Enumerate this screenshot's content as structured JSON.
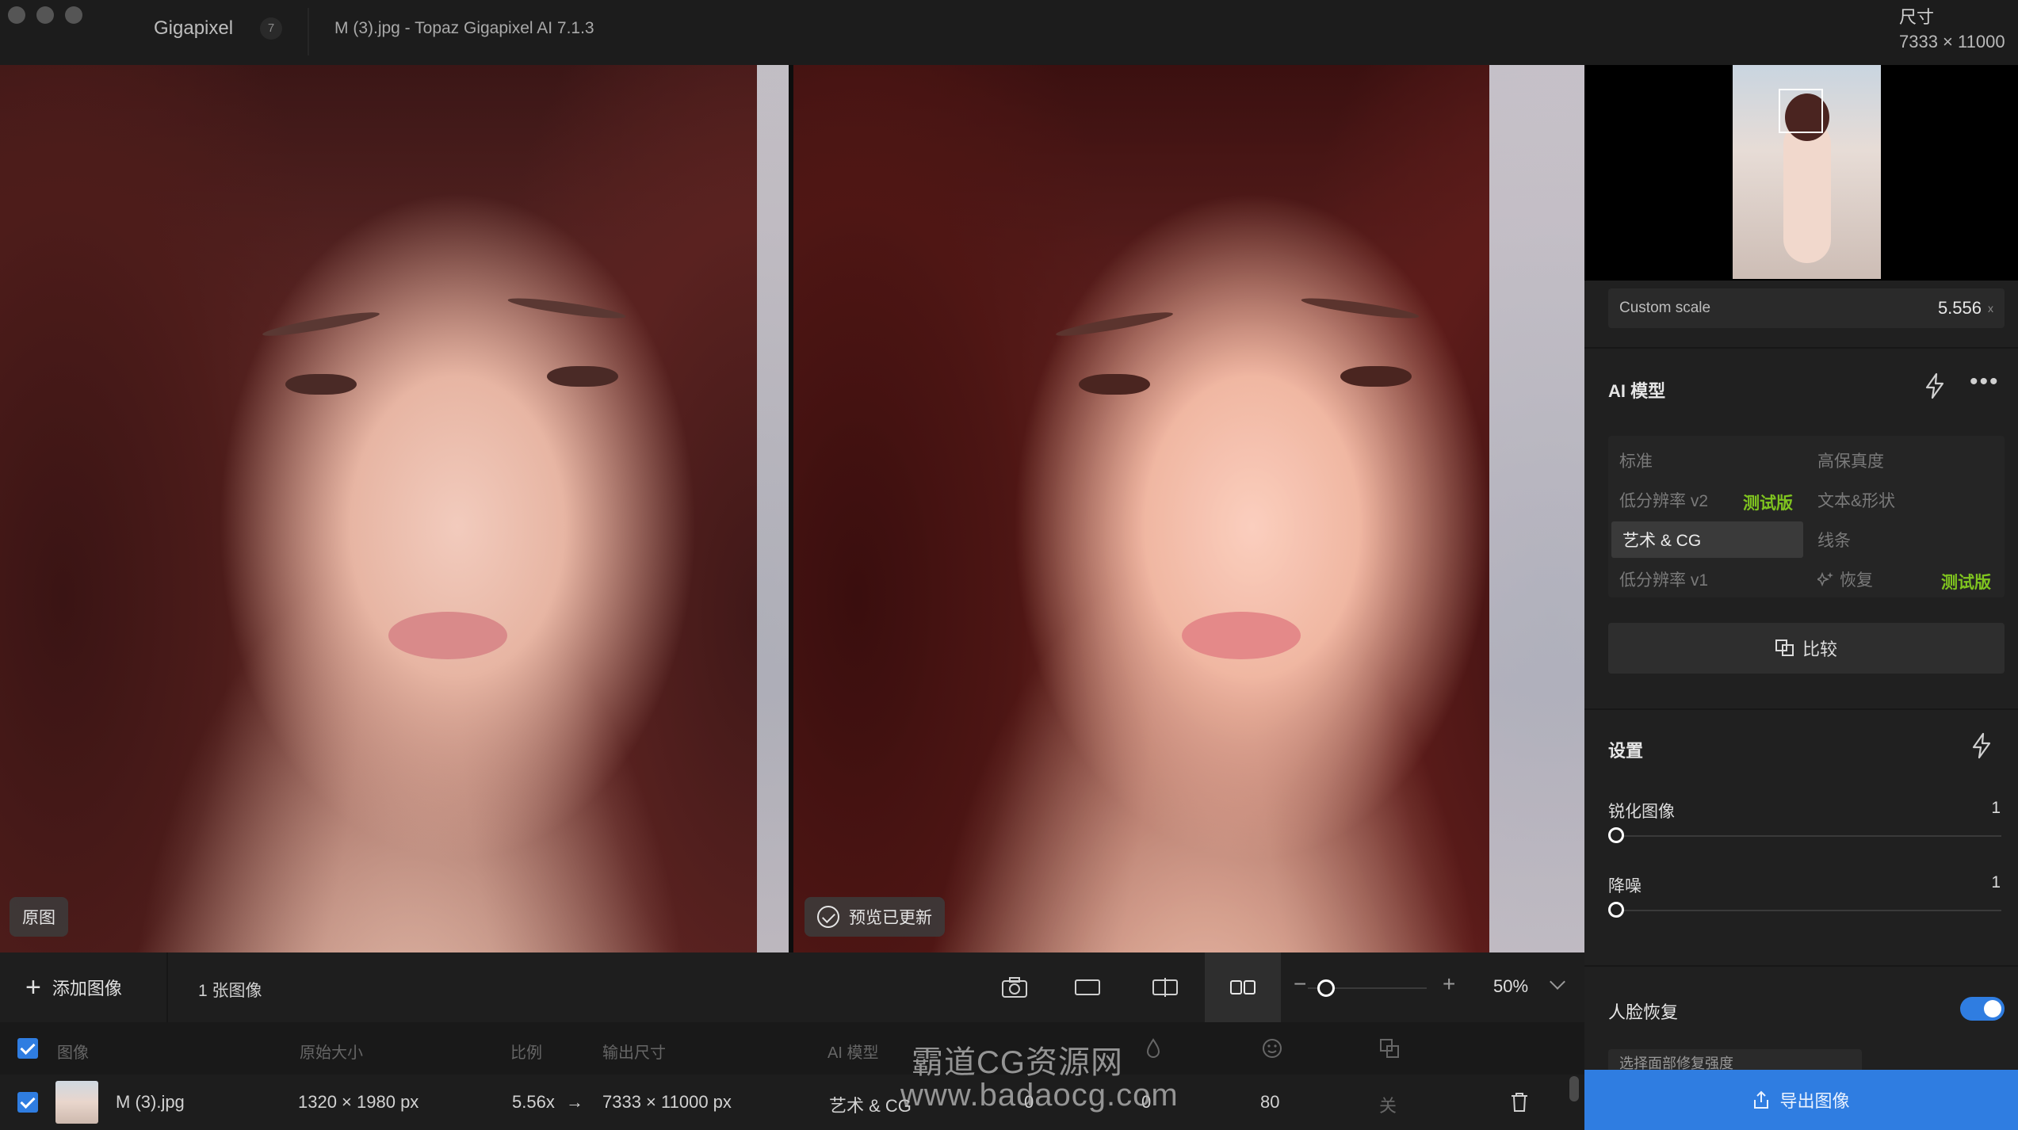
{
  "titlebar": {
    "app_name": "Gigapixel",
    "app_badge": "7",
    "window_title": "M (3).jpg - Topaz Gigapixel AI 7.1.3",
    "size_label": "尺寸",
    "size_value": "7333 × 11000"
  },
  "preview": {
    "left_chip": "原图",
    "right_chip": "预览已更新"
  },
  "sidebar": {
    "custom_scale_label": "Custom scale",
    "custom_scale_value": "5.556",
    "custom_scale_unit": "x",
    "ai_model_title": "AI 模型",
    "models": {
      "standard": "标准",
      "high_fidelity": "高保真度",
      "low_res_v2": "低分辨率 v2",
      "beta_1": "测试版",
      "text_shape": "文本&形状",
      "art_cg": "艺术 & CG",
      "lines": "线条",
      "low_res_v1": "低分辨率 v1",
      "restore": "恢复",
      "beta_2": "测试版"
    },
    "compare_label": "比较",
    "settings_title": "设置",
    "sharpen_label": "锐化图像",
    "sharpen_value": "1",
    "denoise_label": "降噪",
    "denoise_value": "1",
    "face_restore_label": "人脸恢复",
    "face_restore_sub": "选择面部修复强度",
    "export_label": "导出图像"
  },
  "toolbar": {
    "add_image": "添加图像",
    "image_count": "1 张图像",
    "zoom_minus": "−",
    "zoom_plus": "+",
    "zoom_value": "50%"
  },
  "table": {
    "headers": {
      "image": "图像",
      "original_size": "原始大小",
      "scale": "比例",
      "output_size": "输出尺寸",
      "ai_model": "AI 模型"
    },
    "row": {
      "filename": "M (3).jpg",
      "original_size": "1320 × 1980 px",
      "scale": "5.56x",
      "arrow": "→",
      "output_size": "7333 × 11000 px",
      "ai_model": "艺术 & CG",
      "sharpen": "0",
      "denoise": "0",
      "face": "80",
      "color": "关"
    }
  },
  "watermark": {
    "line1": "霸道CG资源网",
    "line2": "www.badaocg.com"
  },
  "colors": {
    "accent": "#2f7de1",
    "beta_green": "#7fc41f"
  }
}
